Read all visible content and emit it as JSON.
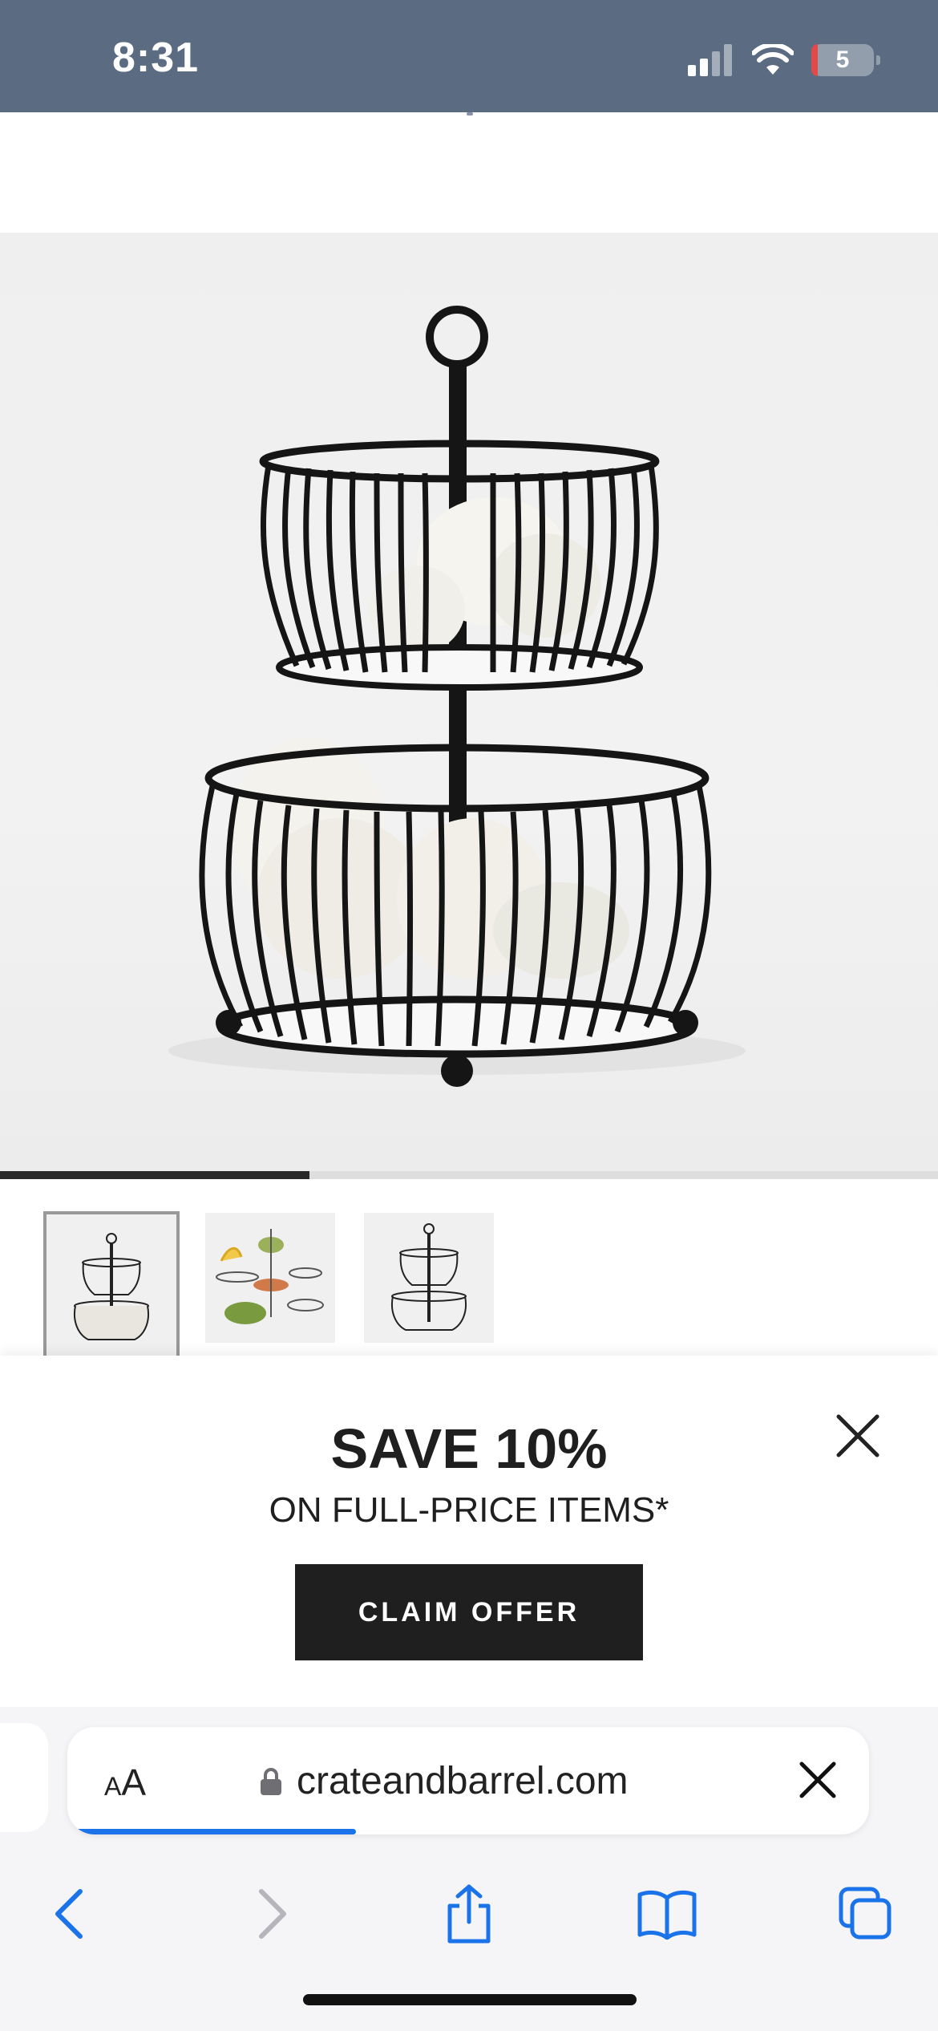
{
  "status_bar": {
    "time": "8:31",
    "battery_level": "5",
    "icons": [
      "cellular-signal-icon",
      "wifi-icon",
      "battery-icon"
    ]
  },
  "gallery": {
    "progress_fraction": 0.33,
    "thumbnails": [
      {
        "name": "thumb-two-tier-basket",
        "selected": true
      },
      {
        "name": "thumb-basket-collection",
        "selected": false
      },
      {
        "name": "thumb-empty-basket",
        "selected": false
      }
    ]
  },
  "promo": {
    "title": "SAVE 10%",
    "subtitle": "ON FULL-PRICE ITEMS*",
    "cta_label": "CLAIM OFFER"
  },
  "browser": {
    "text_size_label_small": "A",
    "text_size_label_large": "A",
    "url": "crateandbarrel.com",
    "load_progress_fraction": 0.36,
    "accent_color": "#1a73e8",
    "toolbar_icons": [
      "back-icon",
      "forward-icon",
      "share-icon",
      "bookmarks-icon",
      "tabs-icon"
    ]
  }
}
